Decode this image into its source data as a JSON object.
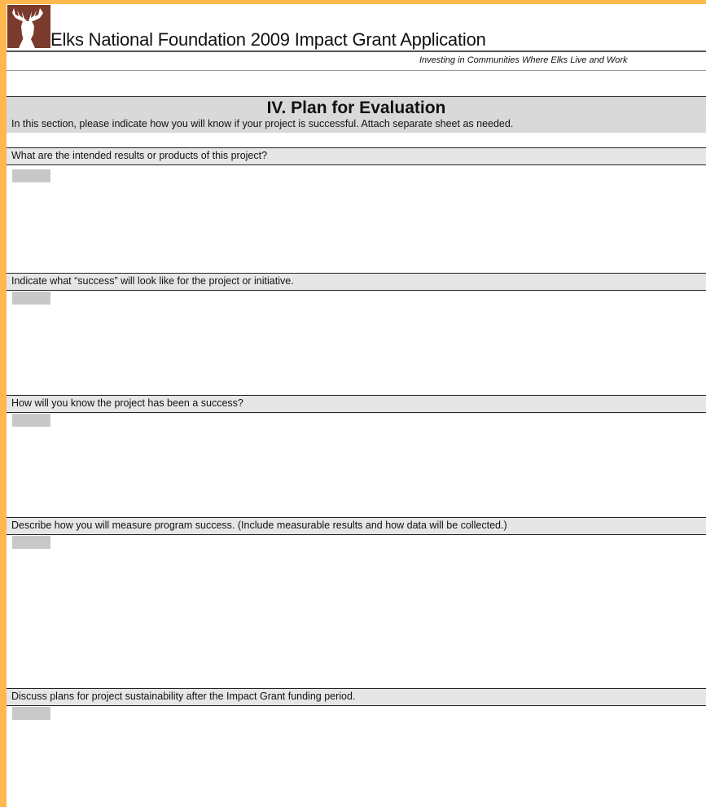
{
  "header": {
    "title": "Elks National Foundation 2009 Impact Grant Application",
    "subtitle": "Investing in Communities Where Elks Live and Work"
  },
  "section": {
    "title": "IV. Plan for Evaluation",
    "description": "In this section, please indicate how you will know if your project is successful. Attach separate sheet as needed."
  },
  "questions": [
    {
      "label": "What are the intended results or products of this project?"
    },
    {
      "label": "Indicate what “success” will look like for the project or initiative."
    },
    {
      "label": "How will you know the project has been a success?"
    },
    {
      "label": "Describe how you will measure program success. (Include measurable results and how data will be collected.)"
    },
    {
      "label": "Discuss plans for project sustainability after the Impact Grant funding period."
    }
  ],
  "colors": {
    "frame": "#ffb84d",
    "logo": "#7b3b2c",
    "section_band": "#d9d9d9",
    "question_band": "#e6e6e6",
    "answer_field": "#c8c8c8"
  },
  "icons": {
    "logo": "elk-head-icon"
  }
}
